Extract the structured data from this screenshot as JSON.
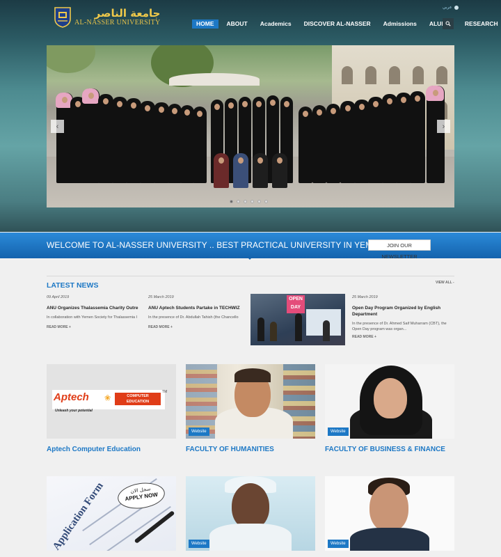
{
  "header": {
    "logo_arabic": "جامعة الناصر",
    "logo_english": "AL-NASSER UNIVERSITY",
    "language_link": "عربي",
    "nav": [
      "HOME",
      "ABOUT",
      "Academics",
      "DISCOVER AL-NASSER",
      "Admissions",
      "ALUMNI",
      "RESEARCH"
    ],
    "active_nav": "HOME"
  },
  "slider": {
    "dots": 6,
    "active_dot": 1,
    "prev_icon": "chevron-left-icon",
    "next_icon": "chevron-right-icon"
  },
  "welcome": {
    "text": "WELCOME TO AL-NASSER UNIVERSITY .. BEST PRACTICAL UNIVERSITY IN YEMEN",
    "newsletter_button": "JOIN OUR NEWSLETTER"
  },
  "news": {
    "title": "LATEST NEWS",
    "view_all": "VIEW ALL -",
    "items": [
      {
        "date": "09 April 2019",
        "title": "ANU Organizes Thalassemia Charity Outre",
        "desc": "In collaboration with Yemen Society for Thalassemia I",
        "more": "READ MORE +"
      },
      {
        "date": "25 March 2019",
        "title": "ANU Aptech Students Partake in TECHWIZ",
        "desc": "In the presence of Dr. Abdullah Tahish (the Chancello",
        "more": "READ MORE +"
      },
      {
        "date": "25 March 2019",
        "title_line1": "Open Day Program Organized by English",
        "title_line2": "Department",
        "desc_line1": "In the presence of Dr. Ahmed Saif Muharram (CBT), the",
        "desc_line2": "Open Day program was organ...",
        "more": "READ MORE +",
        "image_banner": "OPEN DAY"
      }
    ]
  },
  "cards": [
    {
      "title": "Aptech Computer Education",
      "badge": "",
      "logo_word": "Aptech",
      "logo_tag_line1": "COMPUTER",
      "logo_tag_line2": "EDUCATION",
      "logo_slogan": "Unleash your potential",
      "logo_tm": "TM"
    },
    {
      "title": "FACULTY OF HUMANITIES",
      "badge": "Website"
    },
    {
      "title": "FACULTY OF BUSINESS & FINANCE",
      "badge": "Website"
    },
    {
      "title": "",
      "badge": "",
      "apply_ar": "سجل الان",
      "apply_en": "APPLY NOW",
      "form_text": "Application Form"
    },
    {
      "title": "",
      "badge": "Website"
    },
    {
      "title": "",
      "badge": "Website"
    }
  ],
  "colors": {
    "accent": "#1d78c5",
    "welcome_bar": "#1b6fbd",
    "header_dark": "#1c3b45"
  }
}
